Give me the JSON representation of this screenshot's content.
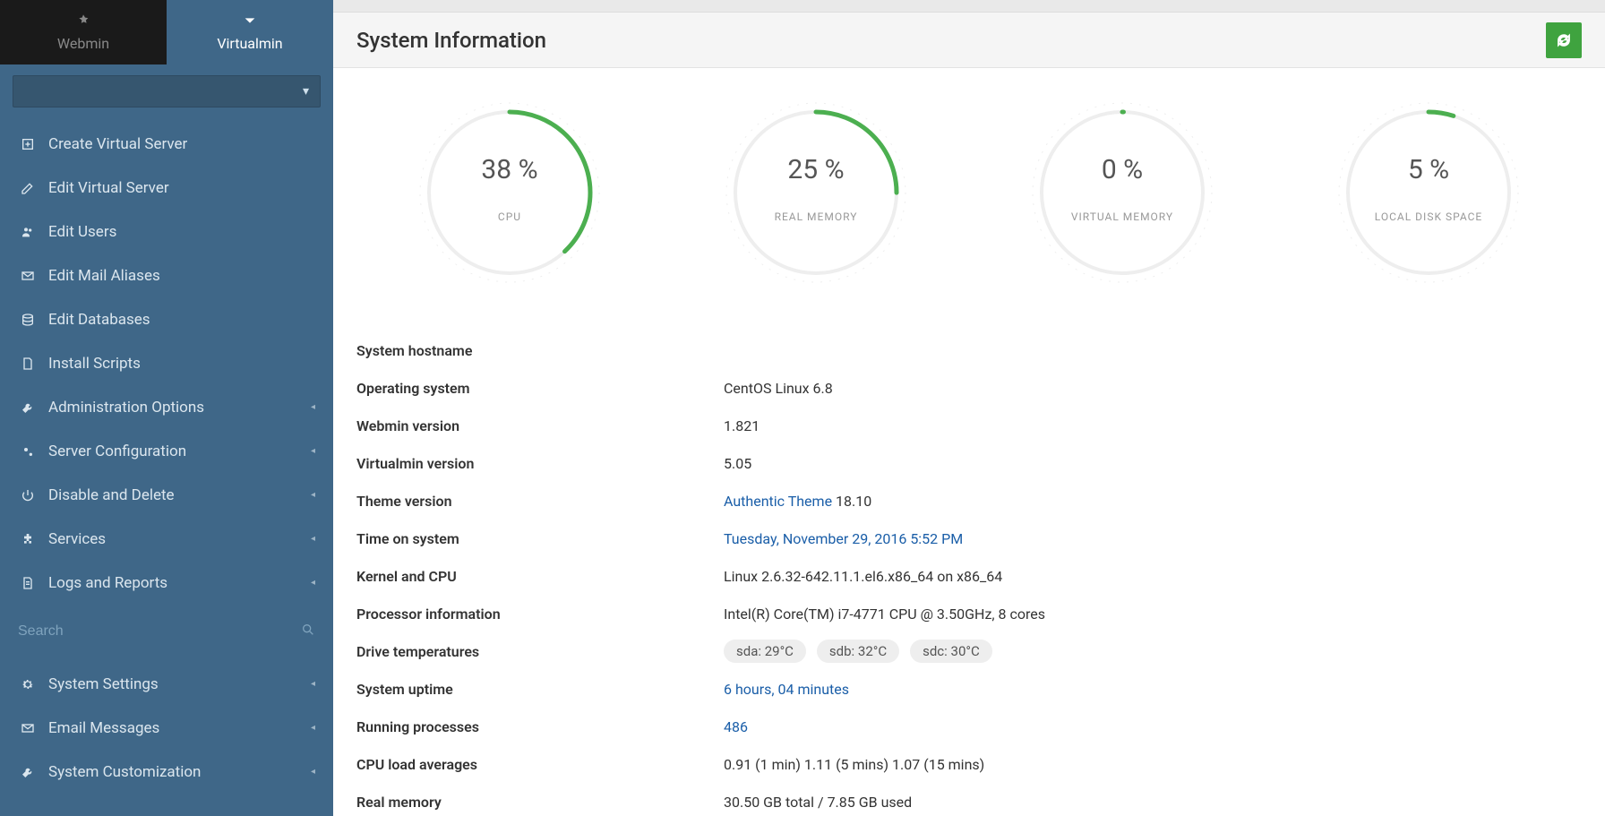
{
  "tabs": {
    "webmin": "Webmin",
    "virtualmin": "Virtualmin"
  },
  "nav": {
    "create_vs": "Create Virtual Server",
    "edit_vs": "Edit Virtual Server",
    "edit_users": "Edit Users",
    "edit_mail": "Edit Mail Aliases",
    "edit_db": "Edit Databases",
    "install_scripts": "Install Scripts",
    "admin_opts": "Administration Options",
    "server_conf": "Server Configuration",
    "disable_delete": "Disable and Delete",
    "services": "Services",
    "logs": "Logs and Reports"
  },
  "nav2": {
    "sys_settings": "System Settings",
    "email_msgs": "Email Messages",
    "sys_custom": "System Customization"
  },
  "search_placeholder": "Search",
  "header": {
    "title": "System Information"
  },
  "chart_data": {
    "type": "gauge",
    "series": [
      {
        "name": "CPU",
        "value": 38
      },
      {
        "name": "REAL MEMORY",
        "value": 25
      },
      {
        "name": "VIRTUAL MEMORY",
        "value": 0
      },
      {
        "name": "LOCAL DISK SPACE",
        "value": 5
      }
    ]
  },
  "gauges": {
    "cpu": {
      "pct": "38 %",
      "label": "CPU"
    },
    "realmem": {
      "pct": "25 %",
      "label": "REAL MEMORY"
    },
    "virtmem": {
      "pct": "0 %",
      "label": "VIRTUAL MEMORY"
    },
    "disk": {
      "pct": "5 %",
      "label": "LOCAL DISK SPACE"
    }
  },
  "info": {
    "hostname_label": "System hostname",
    "hostname_value": "",
    "os_label": "Operating system",
    "os_value": "CentOS Linux 6.8",
    "webmin_label": "Webmin version",
    "webmin_value": "1.821",
    "vmin_label": "Virtualmin version",
    "vmin_value": "5.05",
    "theme_label": "Theme version",
    "theme_link": "Authentic Theme",
    "theme_suffix": " 18.10",
    "time_label": "Time on system",
    "time_value": "Tuesday, November 29, 2016 5:52 PM",
    "kernel_label": "Kernel and CPU",
    "kernel_value": "Linux 2.6.32-642.11.1.el6.x86_64 on x86_64",
    "proc_label": "Processor information",
    "proc_value": "Intel(R) Core(TM) i7-4771 CPU @ 3.50GHz, 8 cores",
    "temps_label": "Drive temperatures",
    "temp_a": "sda: 29°C",
    "temp_b": "sdb: 32°C",
    "temp_c": "sdc: 30°C",
    "uptime_label": "System uptime",
    "uptime_value": "6 hours, 04 minutes",
    "procs_label": "Running processes",
    "procs_value": "486",
    "load_label": "CPU load averages",
    "load_value": "0.91 (1 min) 1.11 (5 mins) 1.07 (15 mins)",
    "realmem_label": "Real memory",
    "realmem_value": "30.50 GB total / 7.85 GB used"
  }
}
